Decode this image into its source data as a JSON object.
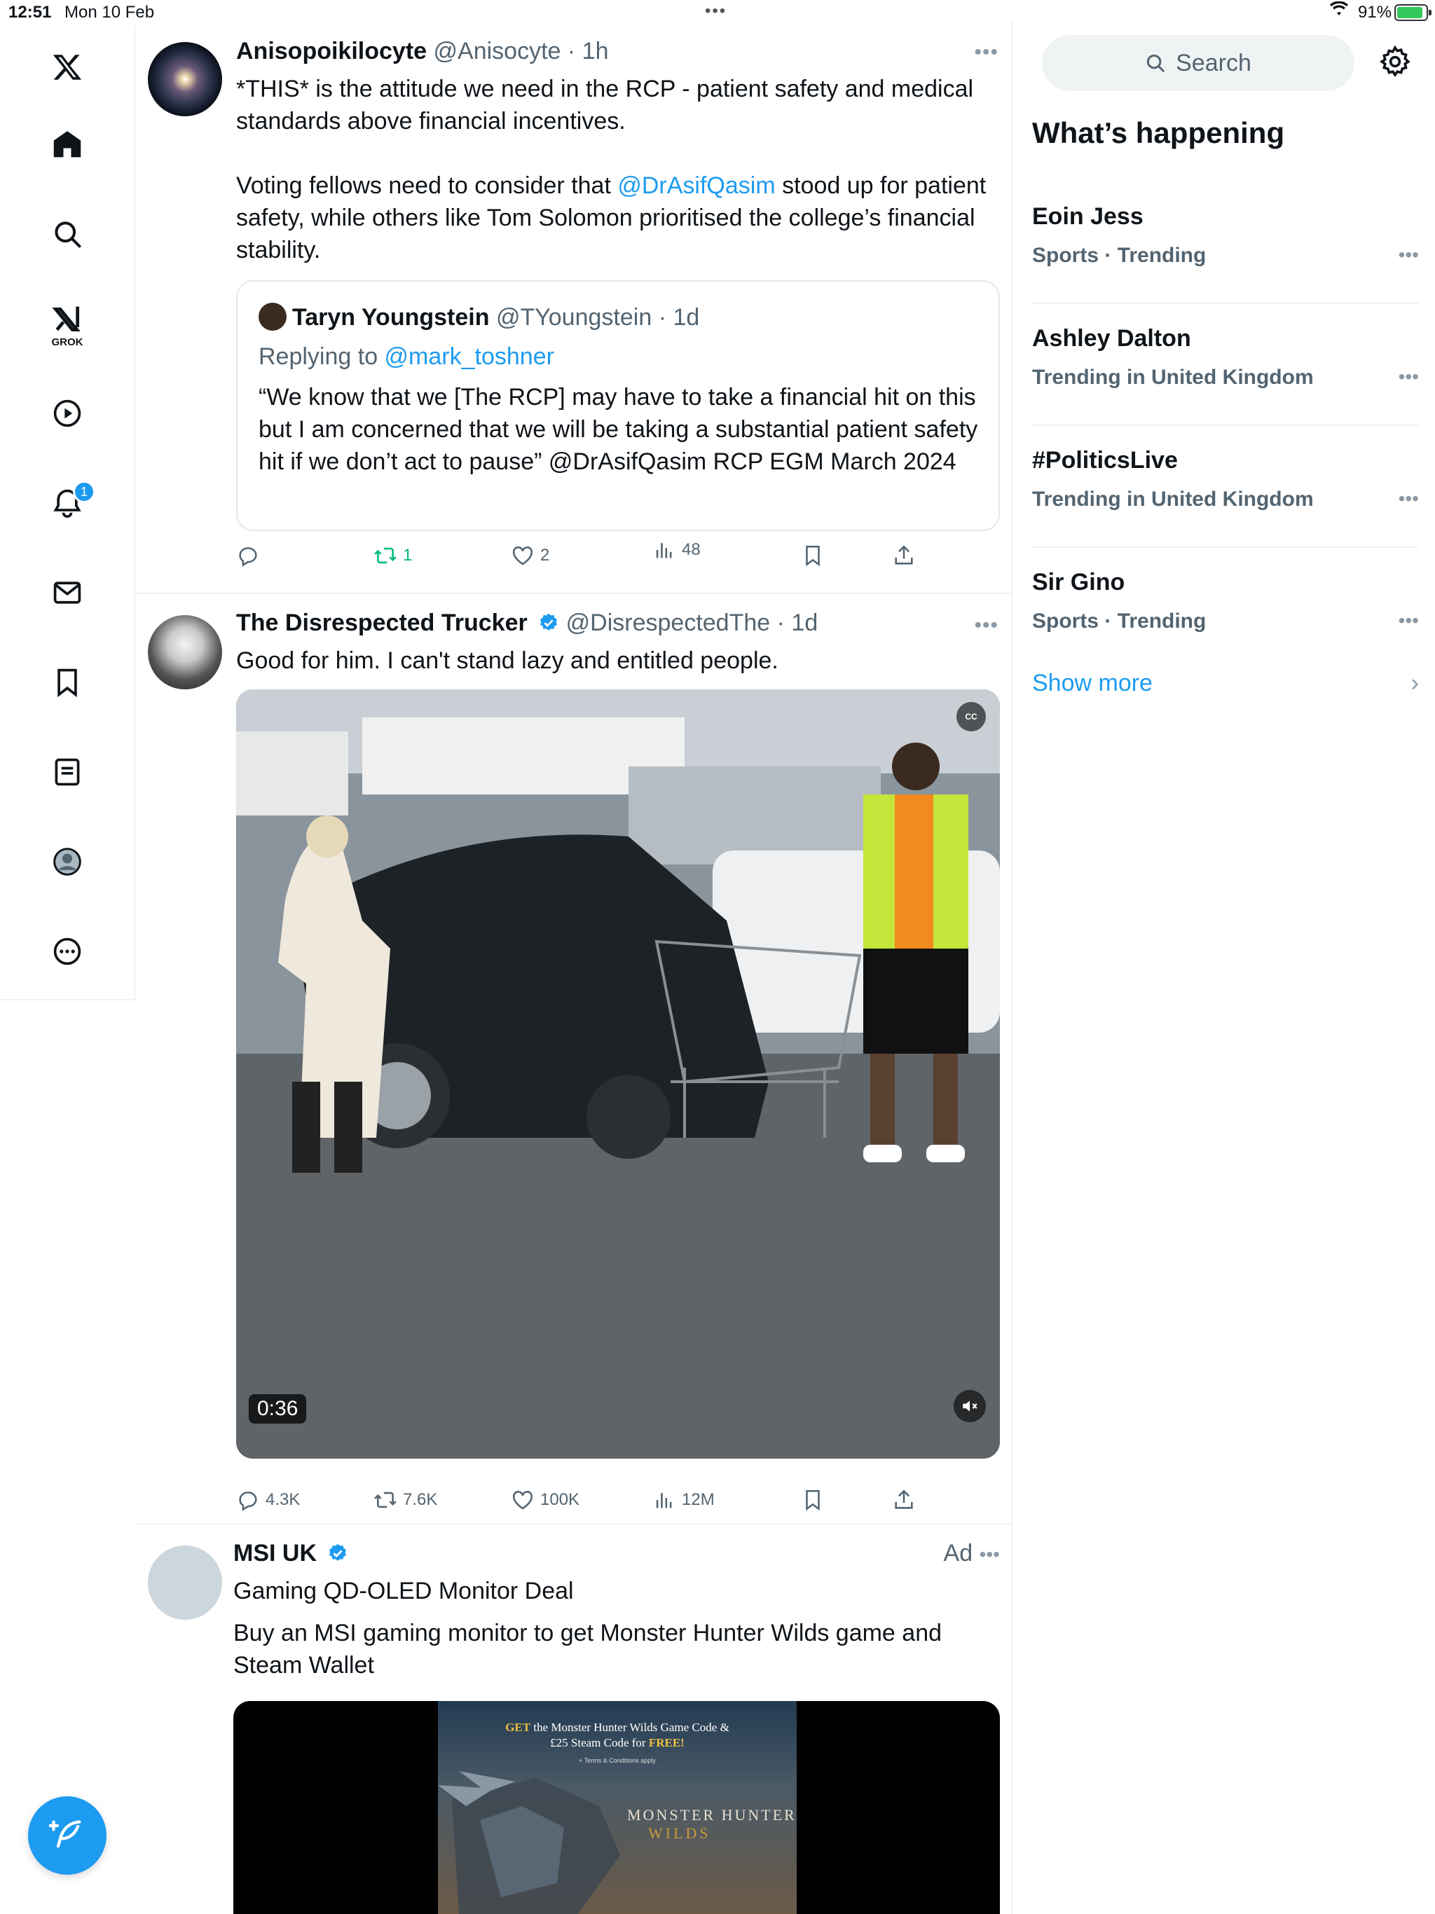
{
  "status_bar": {
    "time": "12:51",
    "date": "Mon 10 Feb",
    "battery": "91%",
    "battery_level": 0.91
  },
  "nav": {
    "grok_label": "GROK",
    "notification_count": "1",
    "icons": [
      "x-logo-icon",
      "home-icon",
      "search-icon",
      "grok-icon",
      "video-icon",
      "notifications-icon",
      "messages-icon",
      "bookmarks-icon",
      "lists-icon",
      "profile-icon",
      "more-icon"
    ]
  },
  "posts": [
    {
      "name": "Anisopoikilocyte",
      "handle": "@Anisocyte",
      "time": "· 1h",
      "text_line1": "*THIS* is the attitude we need in the RCP - patient safety and medical standards above financial incentives.",
      "text_p2_before": "Voting fellows need to consider that ",
      "text_p2_mention": "@DrAsifQasim",
      "text_p2_after": " stood up for patient safety, while others like Tom Solomon prioritised the college’s financial stability.",
      "quote": {
        "name": "Taryn Youngstein",
        "handle": "@TYoungstein",
        "time": "· 1d",
        "replying_prefix": "Replying to ",
        "replying_handle": "@mark_toshner",
        "text": "“We know that we [The RCP] may have to take a financial hit on this but I am concerned that we will be taking a substantial patient safety hit if we don’t act to pause” @DrAsifQasim RCP EGM March 2024"
      },
      "stats": {
        "replies": "",
        "reposts": "1",
        "likes": "2",
        "views": "48"
      }
    },
    {
      "name": "The Disrespected Trucker",
      "handle": "@DisrespectedThe",
      "time": "· 1d",
      "text": "Good for him. I can't stand lazy and entitled people.",
      "video_duration": "0:36",
      "cc_label": "CC",
      "stats": {
        "replies": "4.3K",
        "reposts": "7.6K",
        "likes": "100K",
        "views": "12M"
      }
    },
    {
      "name": "MSI UK",
      "ad_label": "Ad",
      "headline": "Gaming QD-OLED Monitor Deal",
      "text": "Buy an MSI gaming monitor to get Monster Hunter Wilds game and Steam Wallet",
      "banner": {
        "get": "GET",
        "line1": "the Monster Hunter Wilds Game Code &",
        "line2_prefix": "£25 Steam Code for ",
        "line2_free": "FREE!",
        "terms": "+ Terms & Conditions apply",
        "title1": "MONSTER HUNTER",
        "title2": "WILDS"
      }
    }
  ],
  "right": {
    "search_placeholder": "Search",
    "section_title": "What’s happening",
    "trends": [
      {
        "name": "Eoin Jess",
        "meta": "Sports · Trending"
      },
      {
        "name": "Ashley Dalton",
        "meta": "Trending in United Kingdom"
      },
      {
        "name": "#PoliticsLive",
        "meta": "Trending in United Kingdom"
      },
      {
        "name": "Sir Gino",
        "meta": "Sports · Trending"
      }
    ],
    "show_more": "Show more"
  },
  "colors": {
    "accent": "#1d9bf0",
    "repost_green": "#00ba7c",
    "muted": "#536471",
    "border": "#eff3f4"
  }
}
